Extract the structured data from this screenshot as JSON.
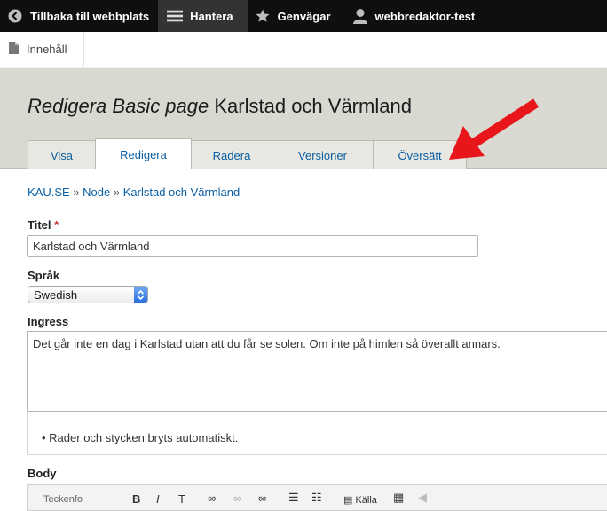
{
  "toolbar": {
    "back": "Tillbaka till webbplats",
    "manage": "Hantera",
    "shortcuts": "Genvägar",
    "user": "webbredaktor-test"
  },
  "tray": {
    "content": "Innehåll"
  },
  "header": {
    "title_prefix": "Redigera Basic page",
    "title_name": "Karlstad och Värmland"
  },
  "tabs": [
    {
      "label": "Visa"
    },
    {
      "label": "Redigera"
    },
    {
      "label": "Radera"
    },
    {
      "label": "Versioner"
    },
    {
      "label": "Översätt"
    }
  ],
  "breadcrumb": {
    "items": [
      "KAU.SE",
      "Node",
      "Karlstad och Värmland"
    ],
    "separator": "»"
  },
  "form": {
    "title_label": "Titel",
    "required_mark": "*",
    "title_value": "Karlstad och Värmland",
    "language_label": "Språk",
    "language_value": "Swedish",
    "ingress_label": "Ingress",
    "ingress_value": "Det går inte en dag i Karlstad utan att du får se solen. Om inte på himlen så överallt annars.",
    "ingress_help": "Rader och stycken bryts automatiskt.",
    "body_label": "Body",
    "editor_format": "Teckenfo",
    "editor_source": "Källa"
  },
  "colors": {
    "toolbar_bg": "#0f0f0f",
    "header_bg": "#d9d8d1",
    "link": "#0a5fa4",
    "arrow": "#e8151b"
  }
}
